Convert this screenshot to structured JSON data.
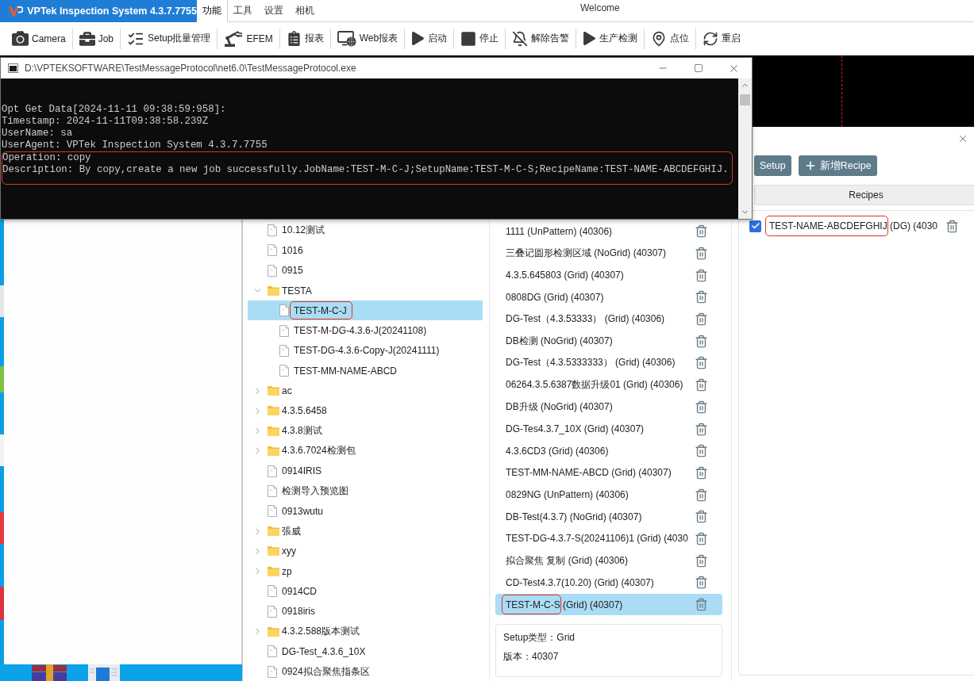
{
  "app": {
    "title": "VPTek Inspection System 4.3.7.7755",
    "menu": [
      {
        "label": "功能",
        "selected": true
      },
      {
        "label": "工具",
        "selected": false
      },
      {
        "label": "设置",
        "selected": false
      },
      {
        "label": "相机",
        "selected": false
      }
    ],
    "welcome": "Welcome"
  },
  "toolbar": [
    {
      "kind": "camera",
      "label": "Camera"
    },
    {
      "kind": "job",
      "label": "Job"
    },
    {
      "kind": "checklist",
      "label": "Setup批量管理"
    },
    {
      "kind": "robot",
      "label": "EFEM"
    },
    {
      "kind": "report",
      "label": "报表"
    },
    {
      "kind": "web",
      "label": "Web报表"
    },
    {
      "kind": "play",
      "label": "启动"
    },
    {
      "kind": "stop",
      "label": "停止"
    },
    {
      "kind": "mute",
      "label": "解除告警"
    },
    {
      "kind": "play",
      "label": "生产检测"
    },
    {
      "kind": "pin",
      "label": "点位"
    },
    {
      "kind": "restart",
      "label": "重启"
    }
  ],
  "console": {
    "title": "D:\\VPTEKSOFTWARE\\TestMessageProtocol\\net6.0\\TestMessageProtocol.exe",
    "lines": [
      {
        "text": "Opt Get Data[2024-11-11 09:38:59:958]:",
        "annotated": false
      },
      {
        "text": "Timestamp: 2024-11-11T09:38:58.239Z",
        "annotated": false
      },
      {
        "text": "UserName: sa",
        "annotated": false
      },
      {
        "text": "UserAgent: VPTek Inspection System 4.3.7.7755",
        "annotated": false
      },
      {
        "text": "Operation: copy",
        "annotated": true
      },
      {
        "text": "Description: By copy,create a new job successfully.JobName:TEST-M-C-J;SetupName:TEST-M-C-S;RecipeName:TEST-NAME-ABCDEFGHIJ.",
        "annotated": true
      }
    ]
  },
  "dialog": {
    "tree": [
      {
        "kind": "file",
        "label": "10.12测试",
        "selected": false,
        "annotated": false
      },
      {
        "kind": "file",
        "label": "1016",
        "selected": false,
        "annotated": false
      },
      {
        "kind": "file",
        "label": "0915",
        "selected": false,
        "annotated": false
      },
      {
        "kind": "folder",
        "label": "TESTA",
        "expanded": true,
        "selected": false,
        "annotated": false,
        "children": [
          {
            "kind": "file",
            "label": "TEST-M-C-J",
            "selected": true,
            "annotated": true
          },
          {
            "kind": "file",
            "label": "TEST-M-DG-4.3.6-J(20241108)",
            "selected": false,
            "annotated": false
          },
          {
            "kind": "file",
            "label": "TEST-DG-4.3.6-Copy-J(20241111)",
            "selected": false,
            "annotated": false
          },
          {
            "kind": "file",
            "label": "TEST-MM-NAME-ABCD",
            "selected": false,
            "annotated": false
          }
        ]
      },
      {
        "kind": "folder",
        "label": "ac",
        "expanded": false,
        "selected": false,
        "annotated": false
      },
      {
        "kind": "folder",
        "label": "4.3.5.6458",
        "expanded": false,
        "selected": false,
        "annotated": false
      },
      {
        "kind": "folder",
        "label": "4.3.8测试",
        "expanded": false,
        "selected": false,
        "annotated": false
      },
      {
        "kind": "folder",
        "label": "4.3.6.7024检测包",
        "expanded": false,
        "selected": false,
        "annotated": false
      },
      {
        "kind": "file",
        "label": "0914IRIS",
        "selected": false,
        "annotated": false
      },
      {
        "kind": "file",
        "label": "检测导入预览图",
        "selected": false,
        "annotated": false
      },
      {
        "kind": "file",
        "label": "0913wutu",
        "selected": false,
        "annotated": false
      },
      {
        "kind": "folder",
        "label": "張威",
        "expanded": false,
        "selected": false,
        "annotated": false
      },
      {
        "kind": "folder",
        "label": "xyy",
        "expanded": false,
        "selected": false,
        "annotated": false
      },
      {
        "kind": "folder",
        "label": "zp",
        "expanded": false,
        "selected": false,
        "annotated": false
      },
      {
        "kind": "file",
        "label": "0914CD",
        "selected": false,
        "annotated": false
      },
      {
        "kind": "file",
        "label": "0918iris",
        "selected": false,
        "annotated": false
      },
      {
        "kind": "folder",
        "label": "4.3.2.588版本测试",
        "expanded": false,
        "selected": false,
        "annotated": false
      },
      {
        "kind": "file",
        "label": "DG-Test_4.3.6_10X",
        "selected": false,
        "annotated": false
      },
      {
        "kind": "file",
        "label": "0924拟合聚焦指条区",
        "selected": false,
        "annotated": false
      }
    ],
    "setups": [
      {
        "label": "1111 (UnPattern) (40306)",
        "selected": false,
        "annotated": false
      },
      {
        "label": "三叠记圆形检测区域 (NoGrid) (40307)",
        "selected": false,
        "annotated": false
      },
      {
        "label": "4.3.5.645803 (Grid) (40307)",
        "selected": false,
        "annotated": false
      },
      {
        "label": "0808DG (Grid) (40307)",
        "selected": false,
        "annotated": false
      },
      {
        "label": "DG-Test（4.3.53333） (Grid) (40306)",
        "selected": false,
        "annotated": false
      },
      {
        "label": "DB检测 (NoGrid) (40307)",
        "selected": false,
        "annotated": false
      },
      {
        "label": "DG-Test（4.3.5333333） (Grid) (40306)",
        "selected": false,
        "annotated": false
      },
      {
        "label": "06264.3.5.6387数据升级01 (Grid) (40306)",
        "selected": false,
        "annotated": false
      },
      {
        "label": "DB升级 (NoGrid) (40307)",
        "selected": false,
        "annotated": false
      },
      {
        "label": "DG-Tes4.3.7_10X (Grid) (40307)",
        "selected": false,
        "annotated": false
      },
      {
        "label": "4.3.6CD3 (Grid) (40306)",
        "selected": false,
        "annotated": false
      },
      {
        "label": "TEST-MM-NAME-ABCD (Grid) (40307)",
        "selected": false,
        "annotated": false
      },
      {
        "label": "0829NG (UnPattern) (40306)",
        "selected": false,
        "annotated": false
      },
      {
        "label": "DB-Test(4.3.7) (NoGrid) (40307)",
        "selected": false,
        "annotated": false
      },
      {
        "label": "TEST-DG-4.3.7-S(20241106)1 (Grid) (4030",
        "selected": false,
        "annotated": false
      },
      {
        "label": "拟合聚焦 复制 (Grid) (40306)",
        "selected": false,
        "annotated": false
      },
      {
        "label": "CD-Test4.3.7(10.20) (Grid) (40307)",
        "selected": false,
        "annotated": false
      },
      {
        "label": "TEST-M-C-S (Grid) (40307)",
        "selected": true,
        "annotated": true
      }
    ],
    "setup_info": [
      "Setup类型：Grid",
      "版本：40307"
    ],
    "buttons": [
      {
        "kind": "setup",
        "label": "Setup"
      },
      {
        "kind": "add",
        "label": "新增Recipe"
      }
    ],
    "recipes_header": "Recipes",
    "recipes": [
      {
        "label": "TEST-NAME-ABCDEFGHIJ (DG) (4030",
        "checked": true,
        "annotated": true
      }
    ]
  }
}
